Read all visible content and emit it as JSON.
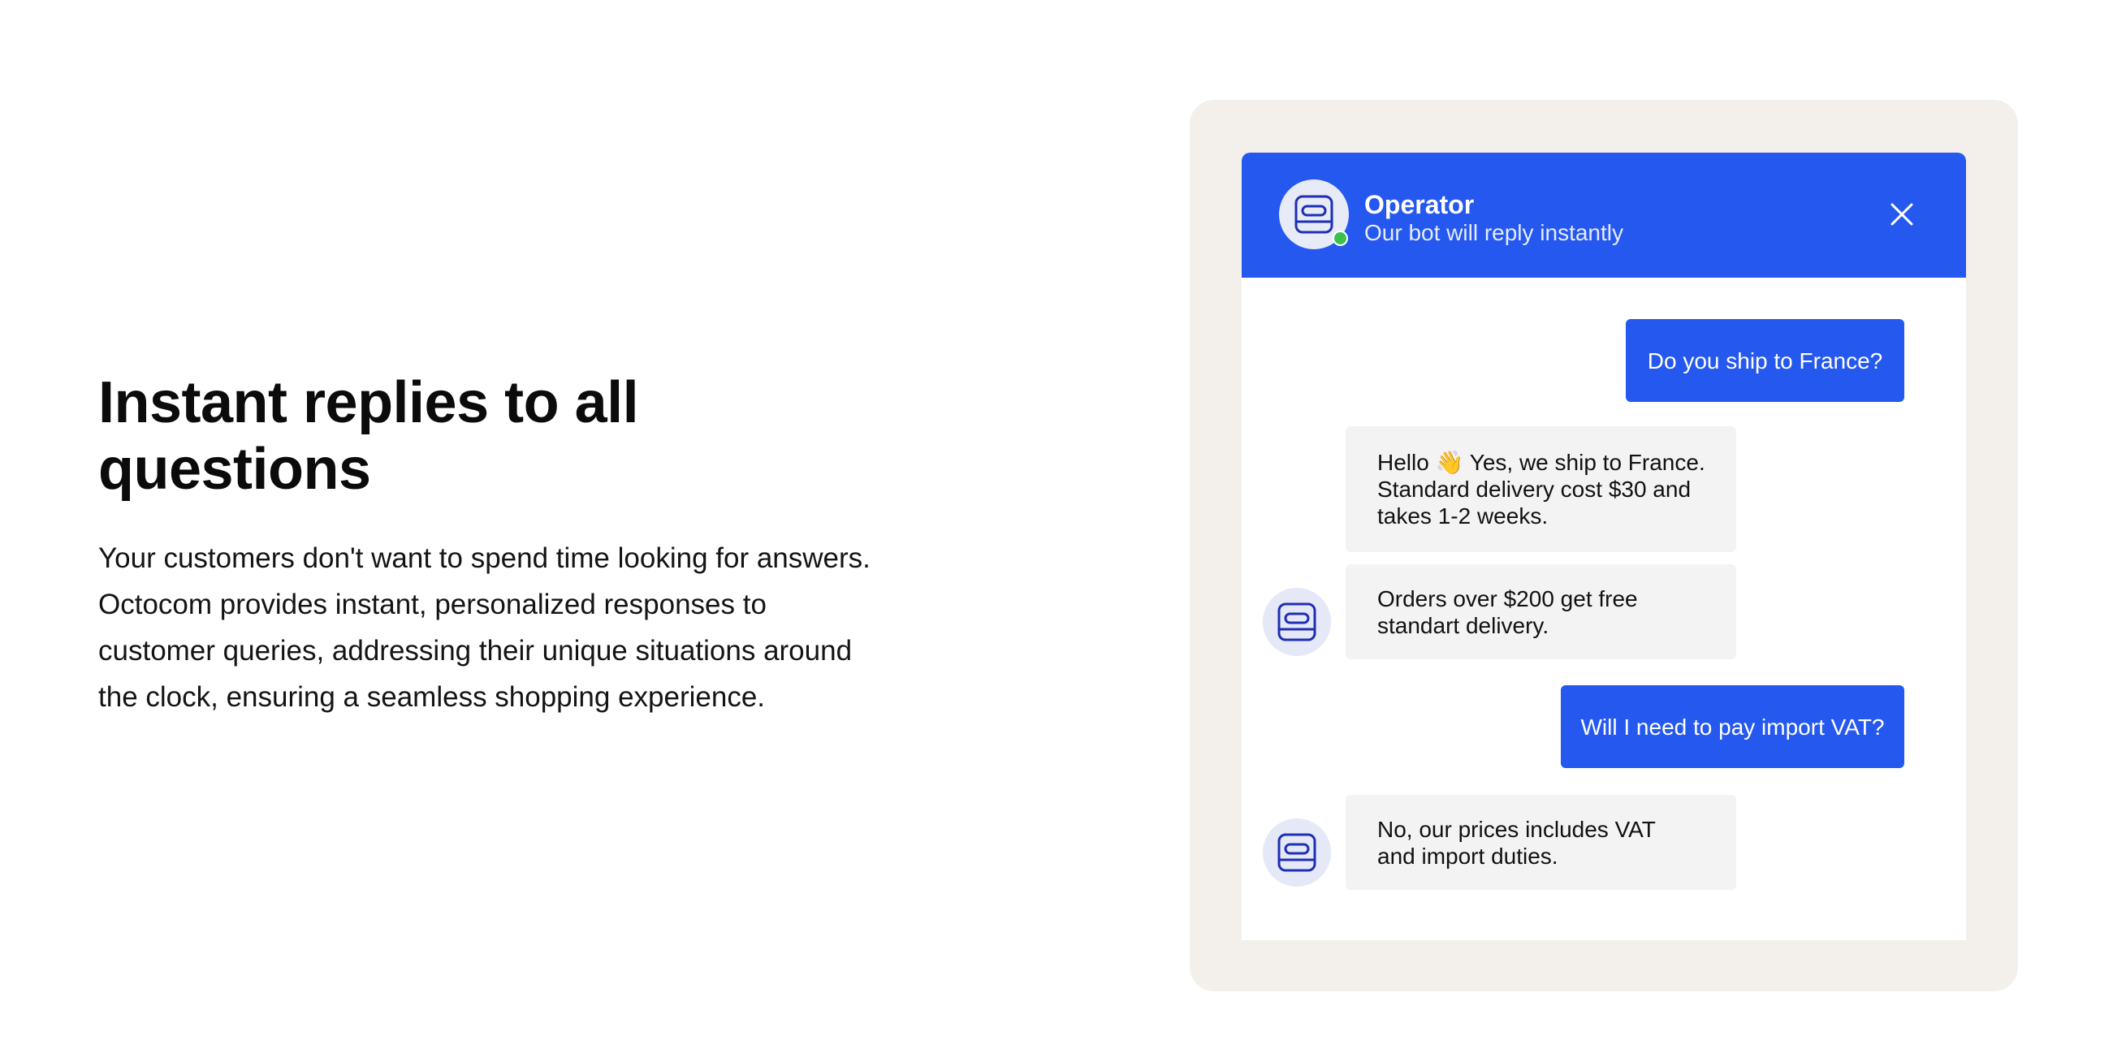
{
  "hero": {
    "headline_lines": [
      "Instant replies to all",
      "questions"
    ],
    "body_lines": [
      "Your customers don't want to spend time looking for answers.",
      "Octocom provides instant, personalized responses to",
      "customer queries, addressing their unique situations around",
      "the clock, ensuring a seamless shopping experience."
    ]
  },
  "chat": {
    "header": {
      "name": "Operator",
      "subtitle": "Our bot will reply instantly",
      "avatar_icon": "bot-icon",
      "status": "online",
      "close_icon": "close-icon"
    },
    "messages": [
      {
        "from": "user",
        "lines": [
          "Do you ship to France?"
        ]
      },
      {
        "from": "bot",
        "lines": [
          "Hello 👋 Yes, we ship to France.",
          "Standard delivery cost $30 and",
          "takes 1-2 weeks."
        ]
      },
      {
        "from": "bot",
        "lines": [
          "Orders over $200 get free",
          "standart delivery."
        ]
      },
      {
        "from": "user",
        "lines": [
          "Will I need to pay import VAT?"
        ]
      },
      {
        "from": "bot",
        "lines": [
          "No, our prices includes VAT",
          "and import duties."
        ]
      }
    ]
  },
  "colors": {
    "accent": "#2558ef",
    "frame": "#f3f0eb",
    "bot_bubble": "#f3f3f3",
    "online": "#39c04d"
  }
}
